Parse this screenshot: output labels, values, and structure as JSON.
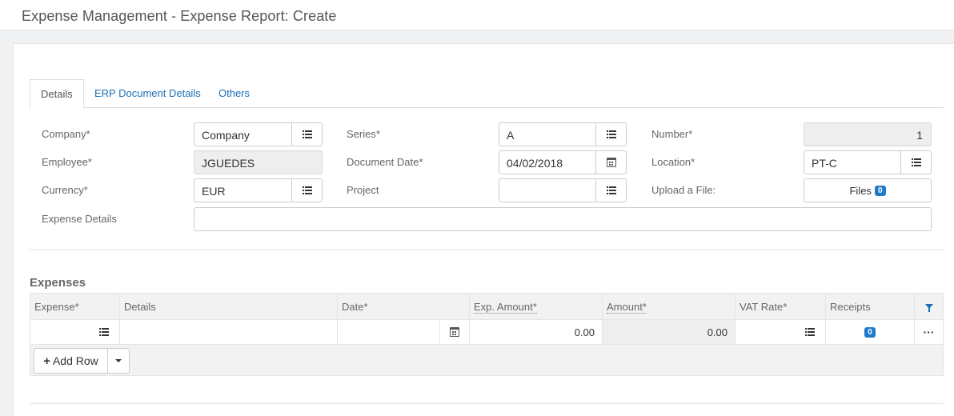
{
  "header": {
    "title": "Expense Management - Expense Report: Create"
  },
  "tabs": [
    {
      "label": "Details",
      "active": true
    },
    {
      "label": "ERP Document Details",
      "active": false
    },
    {
      "label": "Others",
      "active": false
    }
  ],
  "form": {
    "company": {
      "label": "Company*",
      "value": "Company",
      "icon": "list-icon"
    },
    "employee": {
      "label": "Employee*",
      "value": "JGUEDES"
    },
    "currency": {
      "label": "Currency*",
      "value": "EUR",
      "icon": "list-icon"
    },
    "expense_details": {
      "label": "Expense Details",
      "value": ""
    },
    "series": {
      "label": "Series*",
      "value": "A",
      "icon": "list-icon"
    },
    "document_date": {
      "label": "Document Date*",
      "value": "04/02/2018",
      "icon": "calendar-icon"
    },
    "project": {
      "label": "Project",
      "value": "",
      "icon": "list-icon"
    },
    "number": {
      "label": "Number*",
      "value": "1"
    },
    "location": {
      "label": "Location*",
      "value": "PT-C",
      "icon": "list-icon"
    },
    "upload": {
      "label": "Upload a File:",
      "button_label": "Files",
      "count": "0"
    }
  },
  "expenses": {
    "title": "Expenses",
    "columns": [
      "Expense*",
      "Details",
      "Date*",
      "Exp. Amount*",
      "Amount*",
      "VAT Rate*",
      "Receipts"
    ],
    "rows": [
      {
        "expense": "",
        "details": "",
        "date": "",
        "exp_amount": "0.00",
        "amount": "0.00",
        "vat_rate": "",
        "receipts": "0"
      }
    ],
    "add_row_label": "Add Row"
  },
  "colors": {
    "link": "#1f6fb5",
    "badge": "#1f7bc9",
    "readonly_bg": "#eeeeee"
  }
}
